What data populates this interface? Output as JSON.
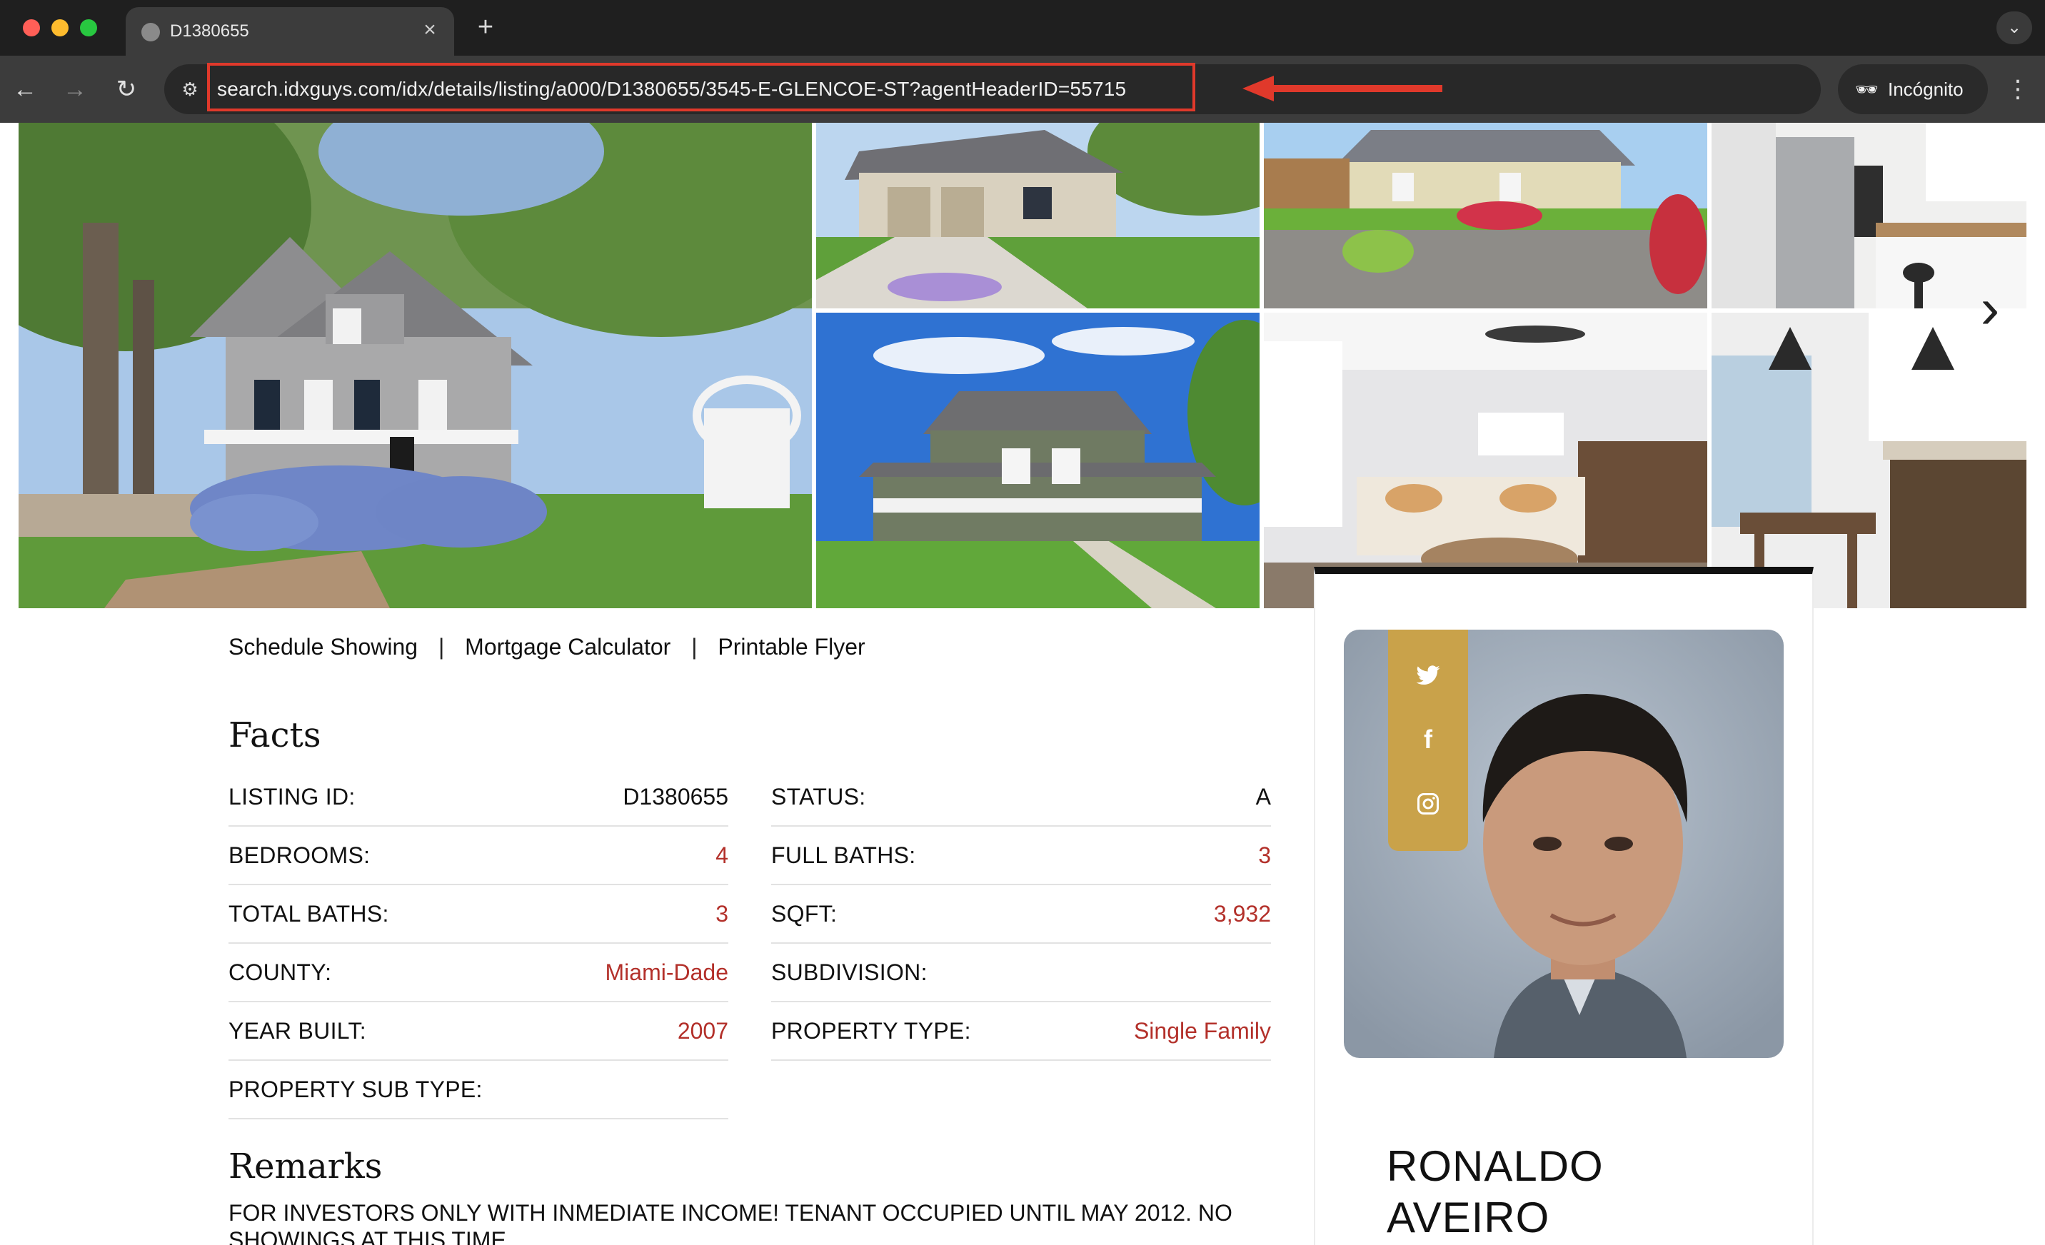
{
  "browser": {
    "tab_title": "D1380655",
    "url": "search.idxguys.com/idx/details/listing/a000/D1380655/3545-E-GLENCOE-ST?agentHeaderID=55715",
    "profile_label": "Incógnito",
    "url_highlight_color": "#e0392b",
    "icons": {
      "back": "arrow-left-icon",
      "forward": "arrow-right-icon",
      "reload": "reload-icon",
      "site_info": "tune-icon",
      "eye_off": "eye-off-icon",
      "bookmark": "star-icon",
      "incognito": "incognito-icon",
      "menu": "kebab-icon"
    }
  },
  "gallery": {
    "photos": [
      "main-house-photo",
      "house-driveway-photo",
      "house-garden-photo",
      "kitchen-photo",
      "two-story-house-photo",
      "living-room-photo",
      "dining-kitchen-photo"
    ],
    "next_icon": "chevron-right-icon"
  },
  "links": {
    "schedule": "Schedule Showing",
    "separator": "|",
    "mortgage": "Mortgage Calculator",
    "flyer": "Printable Flyer"
  },
  "facts": {
    "title": "Facts",
    "left": [
      {
        "label": "LISTING ID:",
        "value": "D1380655"
      },
      {
        "label": "BEDROOMS:",
        "value": "4"
      },
      {
        "label": "TOTAL BATHS:",
        "value": "3"
      },
      {
        "label": "COUNTY:",
        "value": "Miami-Dade"
      },
      {
        "label": "YEAR BUILT:",
        "value": "2007"
      },
      {
        "label": "PROPERTY SUB TYPE:",
        "value": ""
      }
    ],
    "right": [
      {
        "label": "STATUS:",
        "value": "A"
      },
      {
        "label": "FULL BATHS:",
        "value": "3"
      },
      {
        "label": "SQFT:",
        "value": "3,932"
      },
      {
        "label": "SUBDIVISION:",
        "value": ""
      },
      {
        "label": "PROPERTY TYPE:",
        "value": "Single Family"
      }
    ],
    "value_accent_color": "#b3302a"
  },
  "remarks": {
    "title": "Remarks",
    "text": "FOR INVESTORS ONLY WITH INMEDIATE INCOME! TENANT OCCUPIED UNTIL MAY 2012. NO SHOWINGS AT THIS TIME."
  },
  "agent": {
    "first_name": "RONALDO",
    "last_name": "AVEIRO",
    "social_icons": [
      "twitter-icon",
      "facebook-icon",
      "instagram-icon"
    ],
    "social_color": "#c9a24a"
  }
}
